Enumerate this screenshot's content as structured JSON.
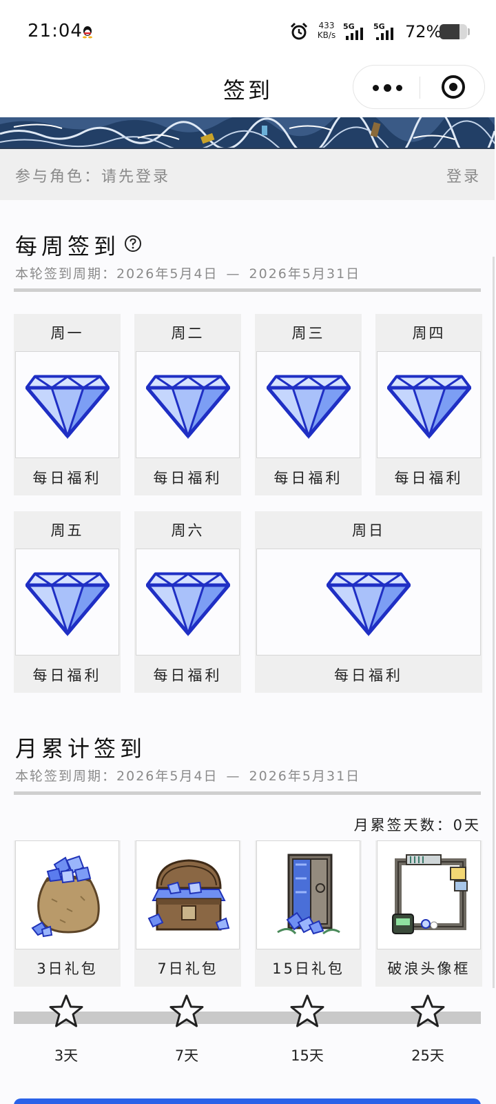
{
  "status_bar": {
    "time": "21:04",
    "net_speed_value": "433",
    "net_speed_unit": "KB/s",
    "signal_1": "5G",
    "signal_2": "5G",
    "battery_percent": "72%",
    "battery_level": 0.72,
    "icons": [
      "qq-icon",
      "alarm-icon",
      "signal-icon",
      "battery-icon"
    ]
  },
  "title_bar": {
    "title": "签到",
    "icons": [
      "more-dots-icon",
      "close-target-icon"
    ]
  },
  "role_bar": {
    "label": "参与角色：请先登录",
    "login": "登录"
  },
  "weekly": {
    "title": "每周签到",
    "period_label": "本轮签到周期：",
    "period_start": "2026年5月4日",
    "period_sep": "—",
    "period_end": "2026年5月31日",
    "days": [
      {
        "day": "周一",
        "reward": "每日福利"
      },
      {
        "day": "周二",
        "reward": "每日福利"
      },
      {
        "day": "周三",
        "reward": "每日福利"
      },
      {
        "day": "周四",
        "reward": "每日福利"
      },
      {
        "day": "周五",
        "reward": "每日福利"
      },
      {
        "day": "周六",
        "reward": "每日福利"
      },
      {
        "day": "周日",
        "reward": "每日福利"
      }
    ]
  },
  "monthly": {
    "title": "月累计签到",
    "period_label": "本轮签到周期：",
    "period_start": "2026年5月4日",
    "period_sep": "—",
    "period_end": "2026年5月31日",
    "count_text": "月累签天数：0天",
    "days_signed": 0,
    "rewards": [
      {
        "name": "3日礼包",
        "milestone": "3天",
        "icon": "gem-sack-icon"
      },
      {
        "name": "7日礼包",
        "milestone": "7天",
        "icon": "treasure-chest-icon"
      },
      {
        "name": "15日礼包",
        "milestone": "15天",
        "icon": "gem-vault-icon"
      },
      {
        "name": "破浪头像框",
        "milestone": "25天",
        "icon": "avatar-frame-icon"
      }
    ]
  },
  "colors": {
    "accent": "#2a62e8",
    "gem": "#7fa3f7",
    "gem_outline": "#2233cc"
  }
}
